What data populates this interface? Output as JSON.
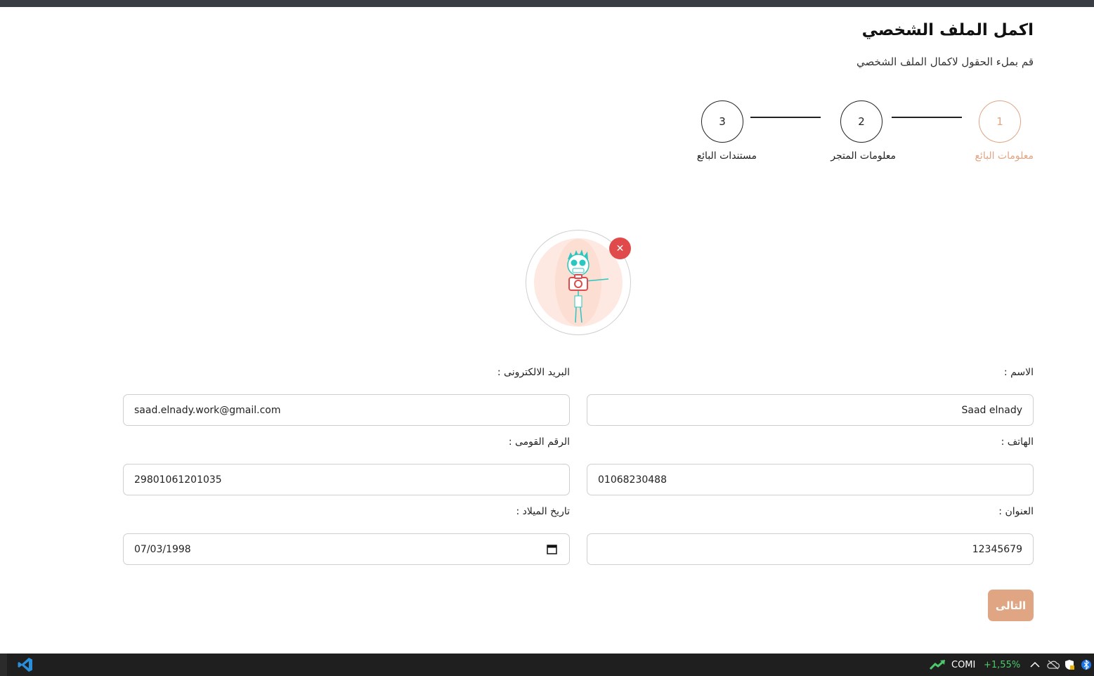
{
  "header": {
    "title": "اكمل الملف الشخصي",
    "subtitle": "قم بملء الحقول لاكمال الملف الشخصي"
  },
  "stepper": {
    "steps": [
      {
        "number": "1",
        "label": "معلومات البائع",
        "active": true
      },
      {
        "number": "2",
        "label": "معلومات المتجر",
        "active": false
      },
      {
        "number": "3",
        "label": "مستندات البائع",
        "active": false
      }
    ]
  },
  "avatar": {
    "remove_symbol": "✕",
    "camera_icon": "camera-icon"
  },
  "form": {
    "name_label": "الاسم :",
    "name_value": "Saad elnady",
    "email_label": "البريد الالكترونى :",
    "email_value": "saad.elnady.work@gmail.com",
    "phone_label": "الهاتف :",
    "phone_value": "01068230488",
    "national_id_label": "الرقم القومى :",
    "national_id_value": "29801061201035",
    "address_label": "العنوان :",
    "address_value": "12345679",
    "birthdate_label": "تاريخ الميلاد :",
    "birthdate_value": "07/03/1998"
  },
  "actions": {
    "next_label": "التالى"
  },
  "taskbar": {
    "stock_symbol": "COMI",
    "stock_change": "+1,55%"
  },
  "colors": {
    "accent": "#e0a583",
    "remove": "#e04a4a",
    "topbar": "#3b3d45",
    "taskbar": "#1f1f1f"
  }
}
